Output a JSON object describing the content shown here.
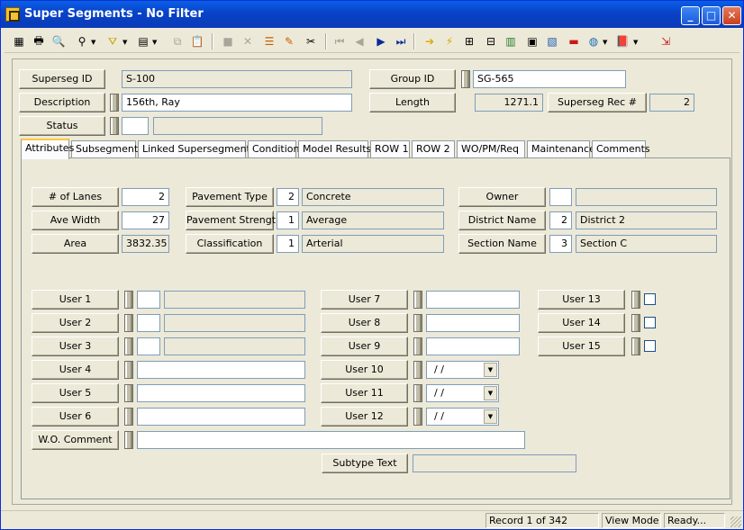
{
  "window": {
    "title": "Super Segments - No Filter",
    "minimize": "_",
    "maximize": "□",
    "close": "✕"
  },
  "header": {
    "superseg_id_label": "Superseg ID",
    "superseg_id_value": "S-100",
    "group_id_label": "Group ID",
    "group_id_value": "SG-565",
    "description_label": "Description",
    "description_value": "156th, Ray",
    "length_label": "Length",
    "length_value": "1271.1",
    "rec_label": "Superseg Rec #",
    "rec_value": "2",
    "status_label": "Status",
    "status_code": "",
    "status_desc": ""
  },
  "tabs": [
    "Attributes",
    "Subsegments",
    "Linked Supersegments",
    "Condition",
    "Model Results",
    "ROW 1",
    "ROW 2",
    "WO/PM/Req",
    "Maintenance",
    "Comments"
  ],
  "attributes": {
    "lanes_label": "# of Lanes",
    "lanes_value": "2",
    "ave_width_label": "Ave Width",
    "ave_width_value": "27",
    "area_label": "Area",
    "area_value": "3832.35",
    "pavement_type_label": "Pavement Type",
    "pavement_type_code": "2",
    "pavement_type_desc": "Concrete",
    "pavement_strength_label": "Pavement Strength",
    "pavement_strength_code": "1",
    "pavement_strength_desc": "Average",
    "classification_label": "Classification",
    "classification_code": "1",
    "classification_desc": "Arterial",
    "owner_label": "Owner",
    "owner_code": "",
    "owner_desc": "",
    "district_label": "District Name",
    "district_code": "2",
    "district_desc": "District 2",
    "section_label": "Section Name",
    "section_code": "3",
    "section_desc": "Section C"
  },
  "user_fields": {
    "user1": "User 1",
    "user2": "User 2",
    "user3": "User 3",
    "user4": "User 4",
    "user5": "User 5",
    "user6": "User 6",
    "user7": "User 7",
    "user8": "User 8",
    "user9": "User 9",
    "user10": "User 10",
    "user11": "User 11",
    "user12": "User 12",
    "user13": "User 13",
    "user14": "User 14",
    "user15": "User 15",
    "date_placeholder": " / /",
    "wo_comment": "W.O. Comment",
    "subtype_text": "Subtype Text"
  },
  "status_bar": {
    "record": "Record 1 of 342",
    "mode": "View Mode",
    "state": "Ready..."
  },
  "toolbar_icons": [
    "grid-icon",
    "print-icon",
    "preview-icon",
    "binoculars-icon",
    "filter-icon",
    "sort-icon",
    "copy-icon",
    "paste-icon",
    "save-icon",
    "delete-icon",
    "stack-icon",
    "edit-icon",
    "cut-icon",
    "first-icon",
    "prev-icon",
    "next-icon",
    "last-icon",
    "goto-icon",
    "flash-icon",
    "map-icon",
    "tree-icon",
    "chart-icon",
    "calc-icon",
    "report-icon",
    "bus-icon",
    "globe-icon",
    "book-icon",
    "export-icon"
  ]
}
